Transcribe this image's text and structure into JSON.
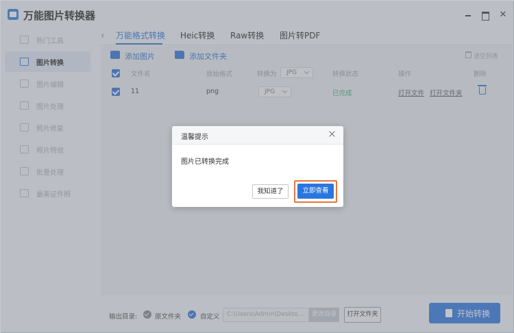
{
  "app": {
    "title": "万能图片转换器"
  },
  "sidebar": {
    "items": [
      {
        "label": "热门工具",
        "active": false
      },
      {
        "label": "图片转换",
        "active": true
      },
      {
        "label": "图片编辑",
        "active": false
      },
      {
        "label": "图片处理",
        "active": false
      },
      {
        "label": "照片修复",
        "active": false
      },
      {
        "label": "照片特效",
        "active": false
      },
      {
        "label": "批量处理",
        "active": false
      },
      {
        "label": "最美证件照",
        "active": false
      }
    ]
  },
  "tabs": [
    {
      "label": "万能格式转换",
      "active": true
    },
    {
      "label": "Heic转换",
      "active": false
    },
    {
      "label": "Raw转换",
      "active": false
    },
    {
      "label": "图片转PDF",
      "active": false
    }
  ],
  "toolbar": {
    "add_image": "添加图片",
    "add_folder": "添加文件夹",
    "clear_list": "清空列表"
  },
  "table": {
    "headers": {
      "filename": "文件名",
      "original_format": "原始格式",
      "convert_to": "转换为",
      "convert_to_value": "JPG",
      "status": "转换状态",
      "actions": "操作",
      "delete": "删除"
    },
    "rows": [
      {
        "filename": "11",
        "original_format": "png",
        "target_format": "JPG",
        "status": "已完成",
        "open_file": "打开文件",
        "open_folder": "打开文件夹"
      }
    ]
  },
  "bottom": {
    "output_label": "输出目录:",
    "option_source": "原文件夹",
    "option_custom": "自定义",
    "path_value": "C:\\Users\\Admin\\Deskto...",
    "change_dir": "更改目录",
    "open_folder": "打开文件夹",
    "start": "开始转换"
  },
  "dialog": {
    "title": "温馨提示",
    "message": "图片已转换完成",
    "ok": "我知道了",
    "view": "立即查看"
  },
  "colors": {
    "accent": "#2a76e0",
    "success": "#37a86b",
    "highlight": "#e8743b"
  }
}
